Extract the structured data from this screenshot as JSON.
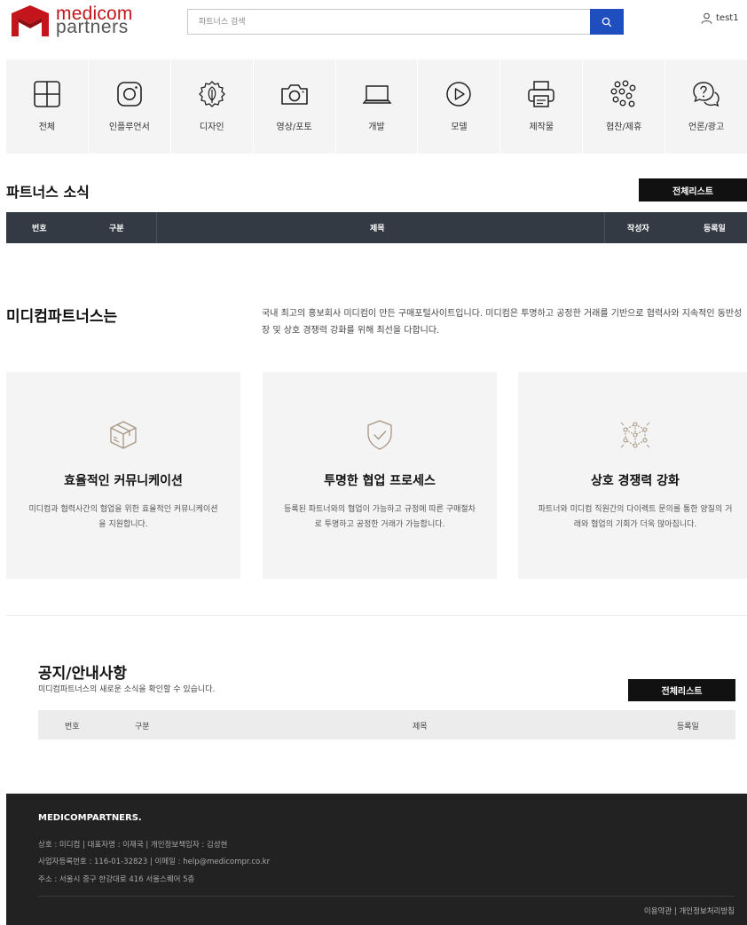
{
  "header": {
    "logo_line1": "medicom",
    "logo_line2": "partners",
    "search_placeholder": "파트너스 검색",
    "username": "test1",
    "brand_red": "#c4151c",
    "search_button_color": "#1f4fbf"
  },
  "categories": [
    {
      "label": "전체",
      "icon": "grid-icon"
    },
    {
      "label": "인플루언서",
      "icon": "instagram-icon"
    },
    {
      "label": "디자인",
      "icon": "leaf-icon"
    },
    {
      "label": "영상/포토",
      "icon": "camera-icon"
    },
    {
      "label": "개발",
      "icon": "laptop-icon"
    },
    {
      "label": "모델",
      "icon": "play-icon"
    },
    {
      "label": "제작물",
      "icon": "printer-icon"
    },
    {
      "label": "협찬/제휴",
      "icon": "dots-cluster-icon"
    },
    {
      "label": "언론/광고",
      "icon": "question-chat-icon"
    }
  ],
  "partners_news": {
    "title": "파트너스 소식",
    "list_button": "전체리스트",
    "columns": {
      "no": "번호",
      "category": "구분",
      "subject": "제목",
      "author": "작성자",
      "date": "등록일"
    }
  },
  "about": {
    "title": "미디컴파트너스는",
    "description": "국내 최고의 홍보회사 미디컴이 만든 구매포털사이트입니다. 미디컴은 투명하고 공정한 거래를 기반으로 협력사와 지속적인 동반성장 및 상호 경쟁력 강화를 위해 최선을 다합니다."
  },
  "features": [
    {
      "title": "효율적인 커뮤니케이션",
      "description": "미디컴과 협력사간의 협업을 위한 효율적인 커뮤니케이션을 지원합니다.",
      "icon": "box-icon"
    },
    {
      "title": "투명한 협업 프로세스",
      "description": "등록된 파트너와의 협업이 가능하고 규정에 따른 구매절차로 투명하고 공정한 거래가 가능합니다.",
      "icon": "shield-check-icon"
    },
    {
      "title": "상호 경쟁력 강화",
      "description": "파트너와 미디컴 직원간의 다이렉트 문의를 통한 양질의 거래와 협업의 기회가 더욱 많아집니다.",
      "icon": "network-cube-icon"
    }
  ],
  "notice": {
    "title": "공지/안내사항",
    "subtitle": "미디컴파트너스의 새로운 소식을 확인할 수 있습니다.",
    "list_button": "전체리스트",
    "columns": {
      "no": "번호",
      "category": "구분",
      "subject": "제목",
      "date": "등록일"
    }
  },
  "footer": {
    "brand": "MEDICOMPARTNERS.",
    "line1": "상호 : 미디컴 | 대표자명 : 이재국 | 개인정보책임자 : 김성현",
    "line2": "사업자등록번호 : 116-01-32823 | 이메일 : help@medicompr.co.kr",
    "line3": "주소 : 서울시 중구 한강대로 416 서울스퀘어 5층",
    "terms": "이용약관",
    "separator": "|",
    "privacy": "개인정보처리방침"
  }
}
